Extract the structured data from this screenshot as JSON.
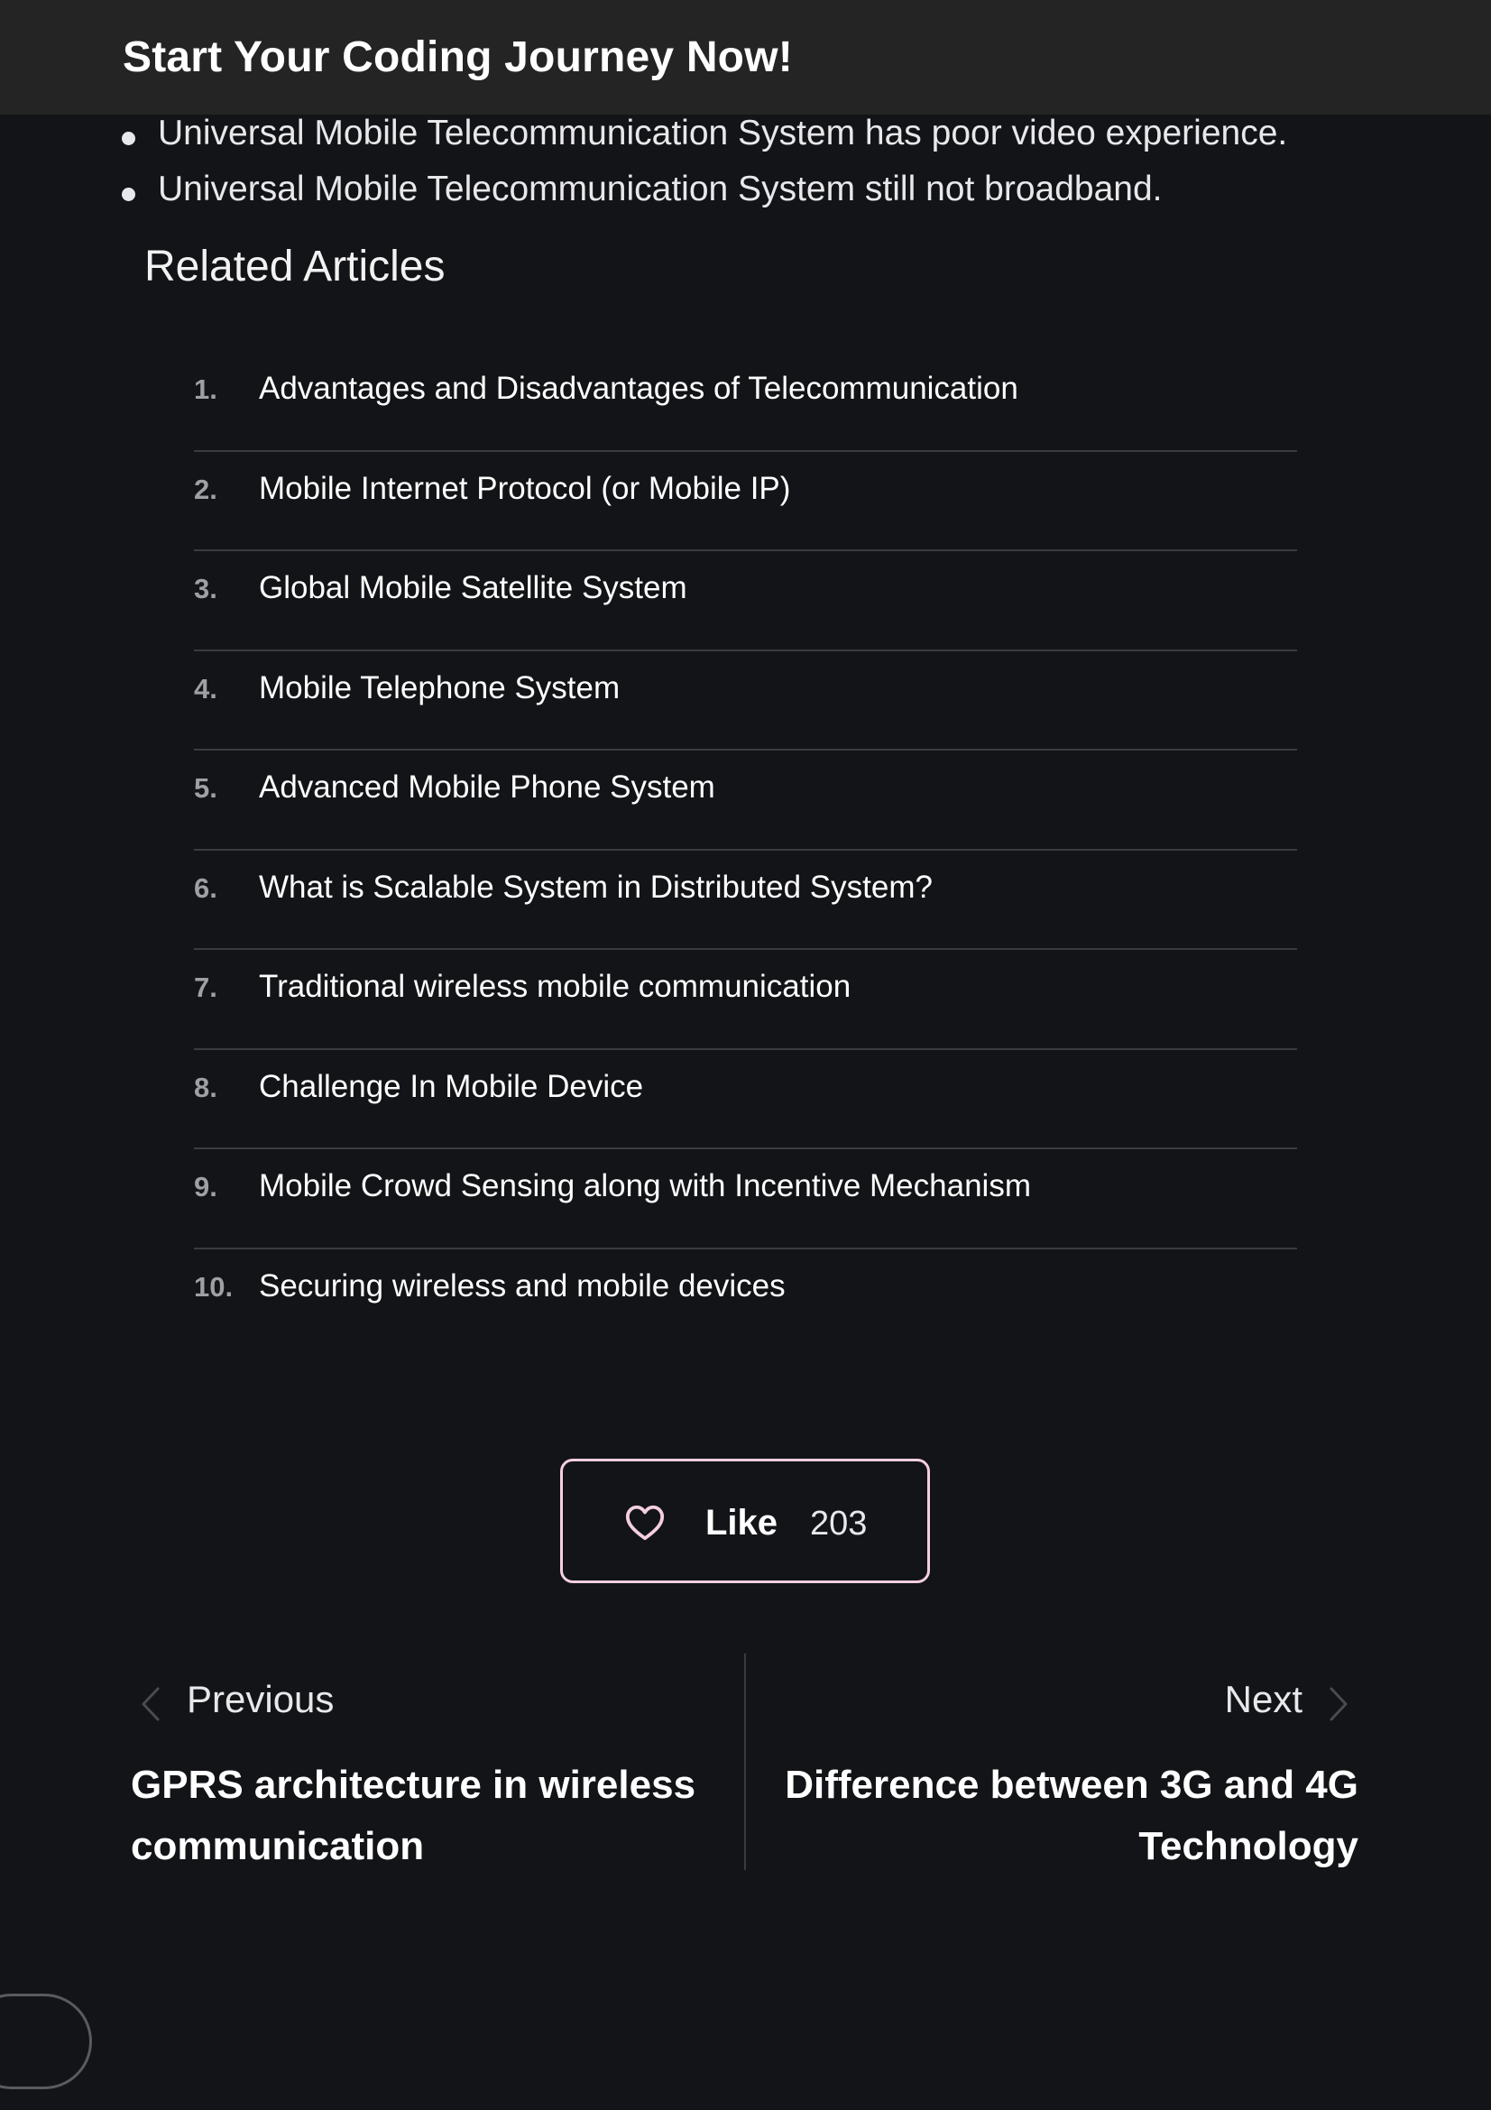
{
  "banner": {
    "title": "Start Your Coding Journey Now!"
  },
  "bullets": [
    "Universal Mobile Telecommunication System has poor video experience.",
    "Universal Mobile Telecommunication System still not broadband."
  ],
  "related": {
    "heading": "Related Articles",
    "items": [
      {
        "num": "1.",
        "label": "Advantages and Disadvantages of Telecommunication"
      },
      {
        "num": "2.",
        "label": "Mobile Internet Protocol (or Mobile IP)"
      },
      {
        "num": "3.",
        "label": "Global Mobile Satellite System"
      },
      {
        "num": "4.",
        "label": "Mobile Telephone System"
      },
      {
        "num": "5.",
        "label": "Advanced Mobile Phone System"
      },
      {
        "num": "6.",
        "label": "What is Scalable System in Distributed System?"
      },
      {
        "num": "7.",
        "label": "Traditional wireless mobile communication"
      },
      {
        "num": "8.",
        "label": "Challenge In Mobile Device"
      },
      {
        "num": "9.",
        "label": "Mobile Crowd Sensing along with Incentive Mechanism"
      },
      {
        "num": "10.",
        "label": "Securing wireless and mobile devices"
      }
    ]
  },
  "like": {
    "label": "Like",
    "count": "203",
    "icon": "heart-icon",
    "border_color": "#f4cfe0"
  },
  "navigation": {
    "previous": {
      "label": "Previous",
      "article": "GPRS architecture in wireless communication"
    },
    "next": {
      "label": "Next",
      "article": "Difference between 3G and 4G Technology"
    }
  },
  "colors": {
    "background": "#131417",
    "banner": "#242424"
  }
}
